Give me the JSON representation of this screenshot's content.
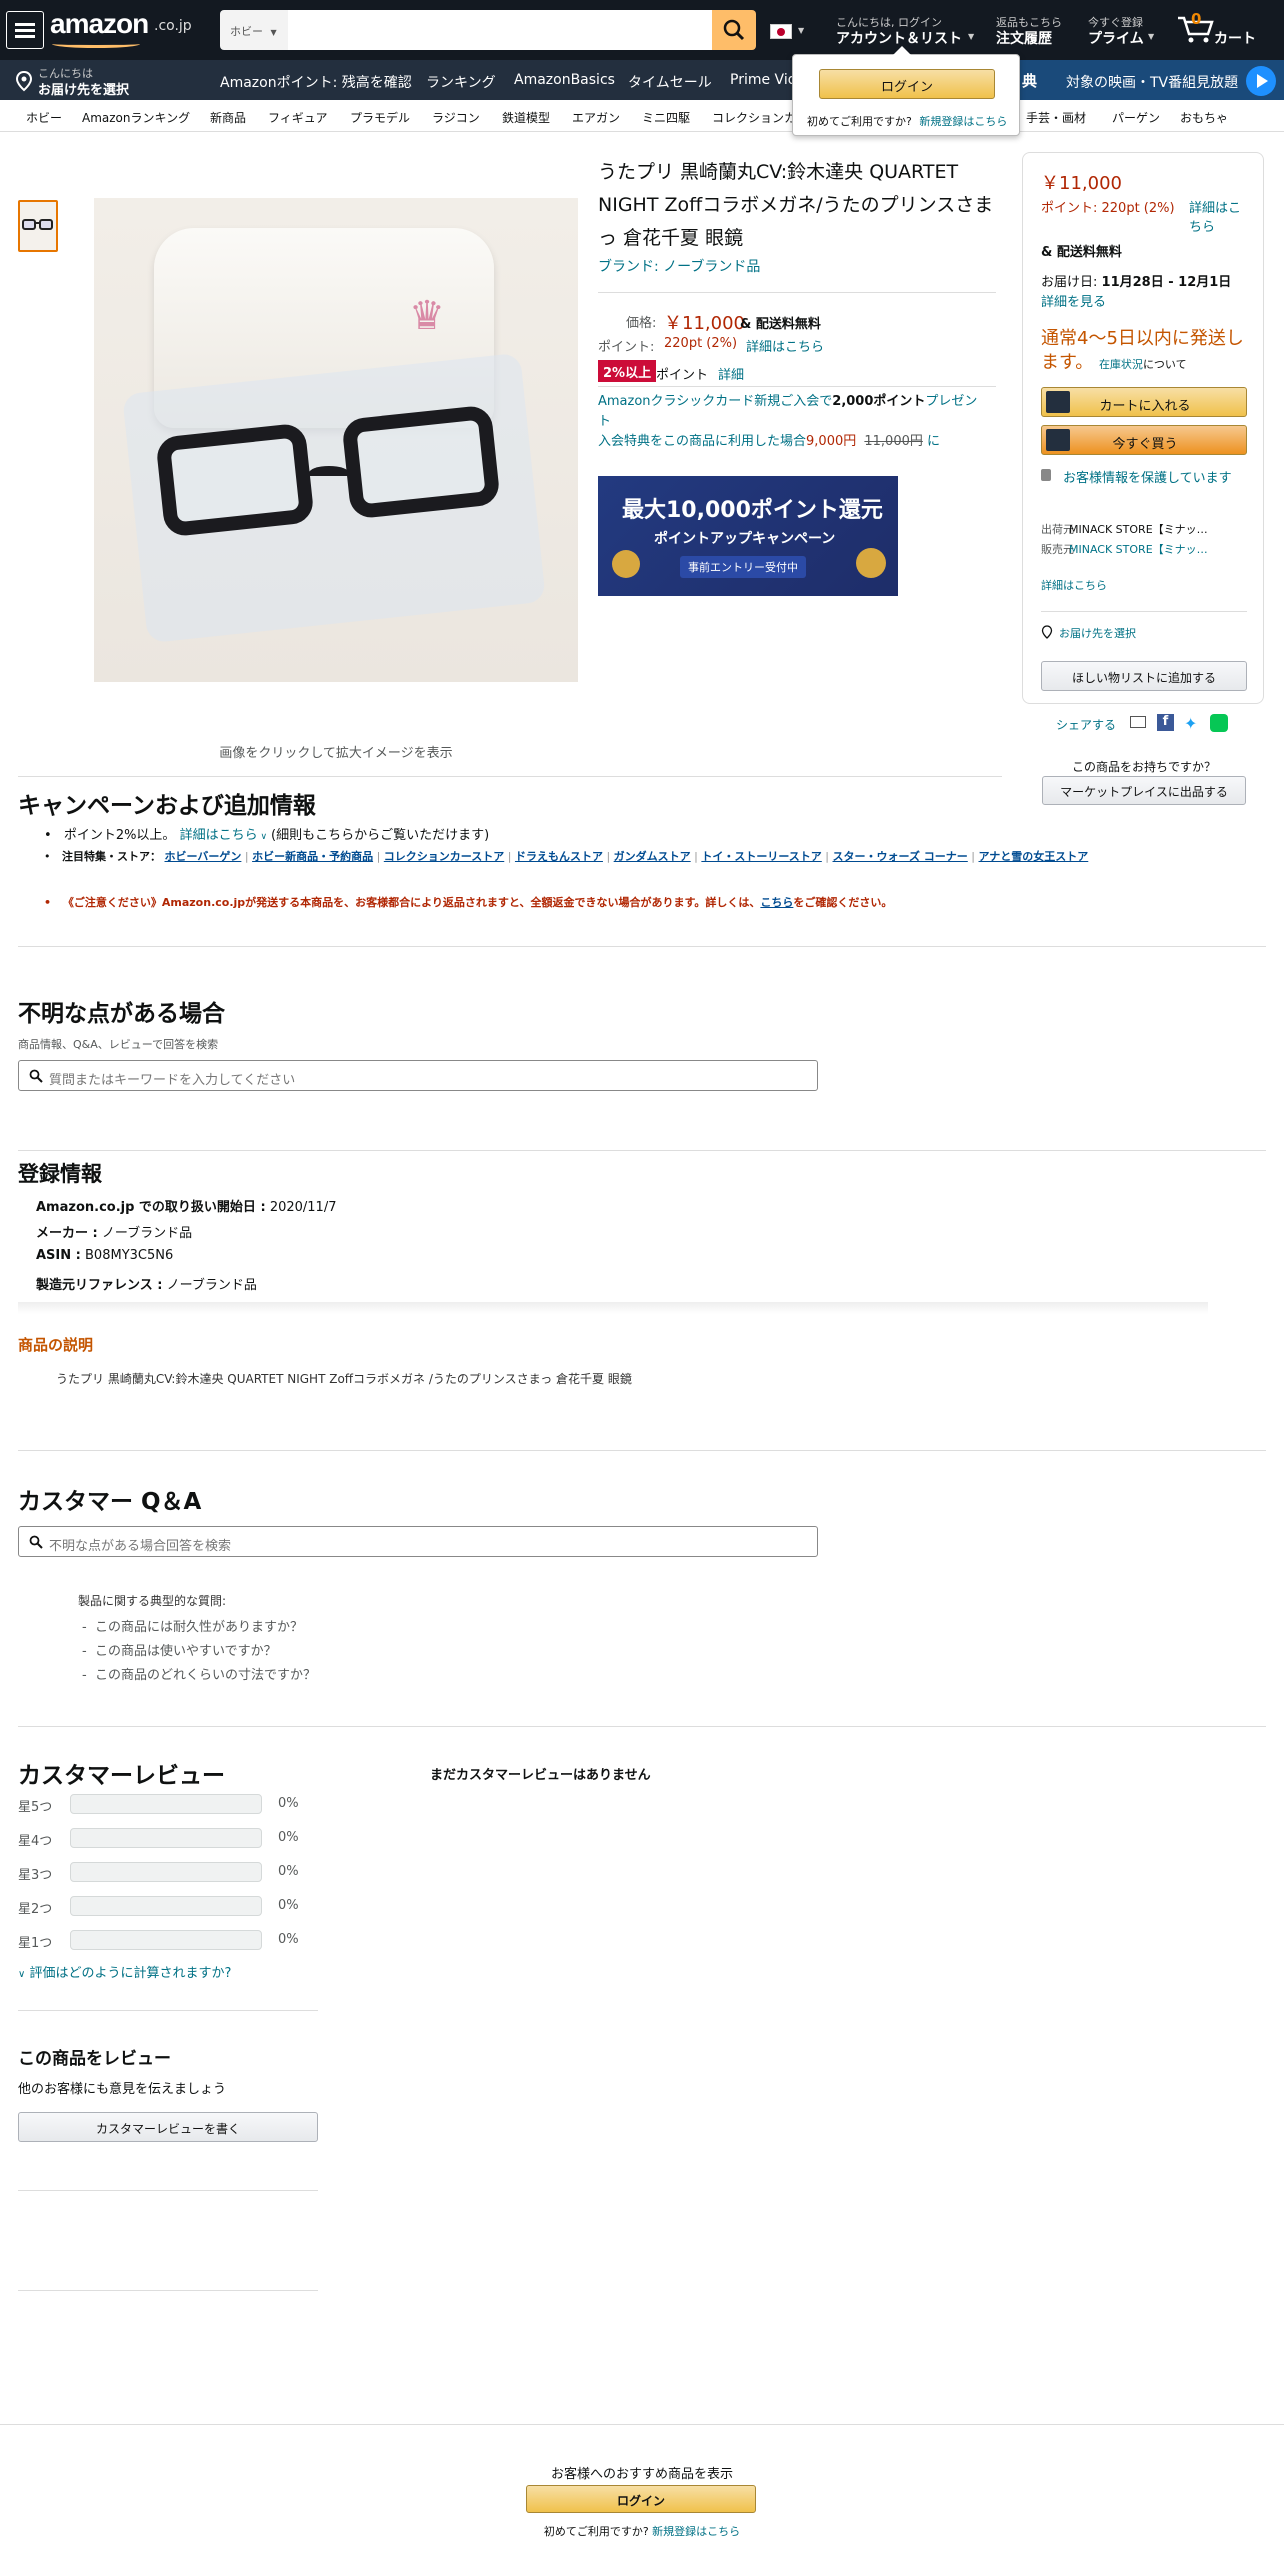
{
  "nav": {
    "logo": "amazon",
    "logo_suffix": ".co.jp",
    "search_category": "ホビー",
    "account_line1": "こんにちは, ログイン",
    "account_line2": "アカウント＆リスト",
    "orders_line1": "返品もこちら",
    "orders_line2": "注文履歴",
    "prime_line1": "今すぐ登録",
    "prime_line2": "プライム",
    "cart_count": "0",
    "cart_label": "カート"
  },
  "nav2": {
    "deliver_line1": "こんにちは",
    "deliver_line2": "お届け先を選択",
    "items": [
      "Amazonポイント: 残高を確認",
      "ランキング",
      "AmazonBasics",
      "タイムセール",
      "Prime Vid"
    ],
    "promo_badge": "典",
    "promo_text": "対象の映画・TV番組見放題"
  },
  "nav3": {
    "items": [
      "ホビー",
      "Amazonランキング",
      "新商品",
      "フィギュア",
      "プラモデル",
      "ラジコン",
      "鉄道模型",
      "エアガン",
      "ミニ四駆",
      "コレクションカ",
      "手芸・画材",
      "パーゲン",
      "おもちゃ"
    ]
  },
  "flyout": {
    "login_button": "ログイン",
    "first_time": "初めてご利用ですか?",
    "register": "新規登録はこちら"
  },
  "product": {
    "title": "うたプリ 黒崎蘭丸CV:鈴木達央 QUARTET NIGHT Zoffコラボメガネ/うたのプリンスさまっ 倉花千夏 眼鏡",
    "brand": "ブランド: ノーブランド品",
    "price_label": "価格:",
    "price": "￥11,000",
    "shipping": "& 配送料無料",
    "points_label": "ポイント:",
    "points_value": "220pt (2%)",
    "points_link": "詳細はこちら",
    "badge": "2%以上",
    "badge_text": "ポイント",
    "badge_link": "詳細",
    "card_promo_1a": "Amazonクラシックカード新規ご入会で",
    "card_promo_1b": "2,000ポイント",
    "card_promo_1c": "プレゼン",
    "card_promo_1d": "ト",
    "card_promo_2a": "入会特典をこの商品に利用した場合",
    "card_promo_2b": "9,000円",
    "card_promo_2c": "11,000円",
    "card_promo_2d": "に",
    "image_caption": "画像をクリックして拡大イメージを表示"
  },
  "campaign_banner": {
    "line1": "最大10,000ポイント還元",
    "line2": "ポイントアップキャンペーン",
    "line3": "事前エントリー受付中"
  },
  "buybox": {
    "price": "￥11,000",
    "points": "ポイント: 220pt (2%)",
    "points_link": "詳細はこちら",
    "shipping": "& 配送料無料",
    "delivery_label": "お届け日:",
    "delivery_date": "11月28日 - 12月1日",
    "delivery_link": "詳細を見る",
    "availability": "通常4～5日以内に発送します。",
    "stock_link": "在庫状況",
    "stock_suffix": "について",
    "cart_button": "カートに入れる",
    "buy_button": "今すぐ買う",
    "secure": "お客様情報を保護しています",
    "ships_from_label": "出荷元",
    "ships_from": "MINACK STORE【ミナッ…",
    "sold_by_label": "販売元",
    "sold_by": "MINACK STORE【ミナッ…",
    "details_link": "詳細はこちら",
    "deliver_to": "お届け先を選択",
    "wishlist": "ほしい物リストに追加する",
    "share": "シェアする",
    "have_one": "この商品をお持ちですか？",
    "sell_button": "マーケットプレイスに出品する"
  },
  "campaign_section": {
    "heading": "キャンペーンおよび追加情報",
    "bullet1_text": "ポイント2%以上。",
    "bullet1_link": "詳細はこちら",
    "bullet1_suffix": "(細則もこちらからご覧いただけます)",
    "stores_label": "注目特集・ストア：",
    "stores": [
      "ホビーバーゲン",
      "ホビー新商品・予約商品",
      "コレクションカーストア",
      "ドラえもんストア",
      "ガンダムストア",
      "トイ・ストーリーストア",
      "スター・ウォーズ コーナー",
      "アナと雪の女王ストア"
    ],
    "notice": "《ご注意ください》Amazon.co.jpが発送する本商品を、お客様都合により返品されますと、全額返金できない場合があります。詳しくは、",
    "notice_link": "こちら",
    "notice_suffix": "をご確認ください。"
  },
  "questions": {
    "heading": "不明な点がある場合",
    "subtext": "商品情報、Q&A、レビューで回答を検索",
    "placeholder": "質問またはキーワードを入力してください"
  },
  "registration": {
    "heading": "登録情報",
    "rows": [
      {
        "label": "Amazon.co.jp での取り扱い開始日 :",
        "value": "2020/11/7"
      },
      {
        "label": "メーカー :",
        "value": "ノーブランド品"
      },
      {
        "label": "ASIN :",
        "value": "B08MY3C5N6"
      },
      {
        "label": "製造元リファレンス :",
        "value": "ノーブランド品"
      }
    ]
  },
  "description": {
    "heading": "商品の説明",
    "text": "うたプリ 黒崎蘭丸CV:鈴木達央 QUARTET NIGHT Zoffコラボメガネ /うたのプリンスさまっ 倉花千夏 眼鏡"
  },
  "qa": {
    "heading": "カスタマー Q＆A",
    "placeholder": "不明な点がある場合回答を検索",
    "typical_label": "製品に関する典型的な質問:",
    "questions": [
      "この商品には耐久性がありますか？",
      "この商品は使いやすいですか？",
      "この商品のどれくらいの寸法ですか？"
    ]
  },
  "reviews": {
    "heading": "カスタマーレビュー",
    "none": "まだカスタマーレビューはありません",
    "stars": [
      {
        "label": "星5つ",
        "pct": "0%",
        "fraction": 0
      },
      {
        "label": "星4つ",
        "pct": "0%",
        "fraction": 0
      },
      {
        "label": "星3つ",
        "pct": "0%",
        "fraction": 0
      },
      {
        "label": "星2つ",
        "pct": "0%",
        "fraction": 0
      },
      {
        "label": "星1つ",
        "pct": "0%",
        "fraction": 0
      }
    ],
    "how_calculated": "評価はどのように計算されますか?",
    "write_heading": "この商品をレビュー",
    "write_sub": "他のお客様にも意見を伝えましょう",
    "write_button": "カスタマーレビューを書く"
  },
  "footer_login": {
    "text": "お客様へのおすすめ商品を表示",
    "button": "ログイン",
    "first_time": "初めてご利用ですか?",
    "register": "新規登録はこちら"
  },
  "colors": {
    "nav_bg": "#131921",
    "nav2_bg": "#232f3e",
    "price_red": "#b12704",
    "link": "#007185",
    "availability": "#c45500",
    "notice_red": "#b12704",
    "button_yellow": "#f0c14b",
    "button_orange": "#ed9220"
  }
}
